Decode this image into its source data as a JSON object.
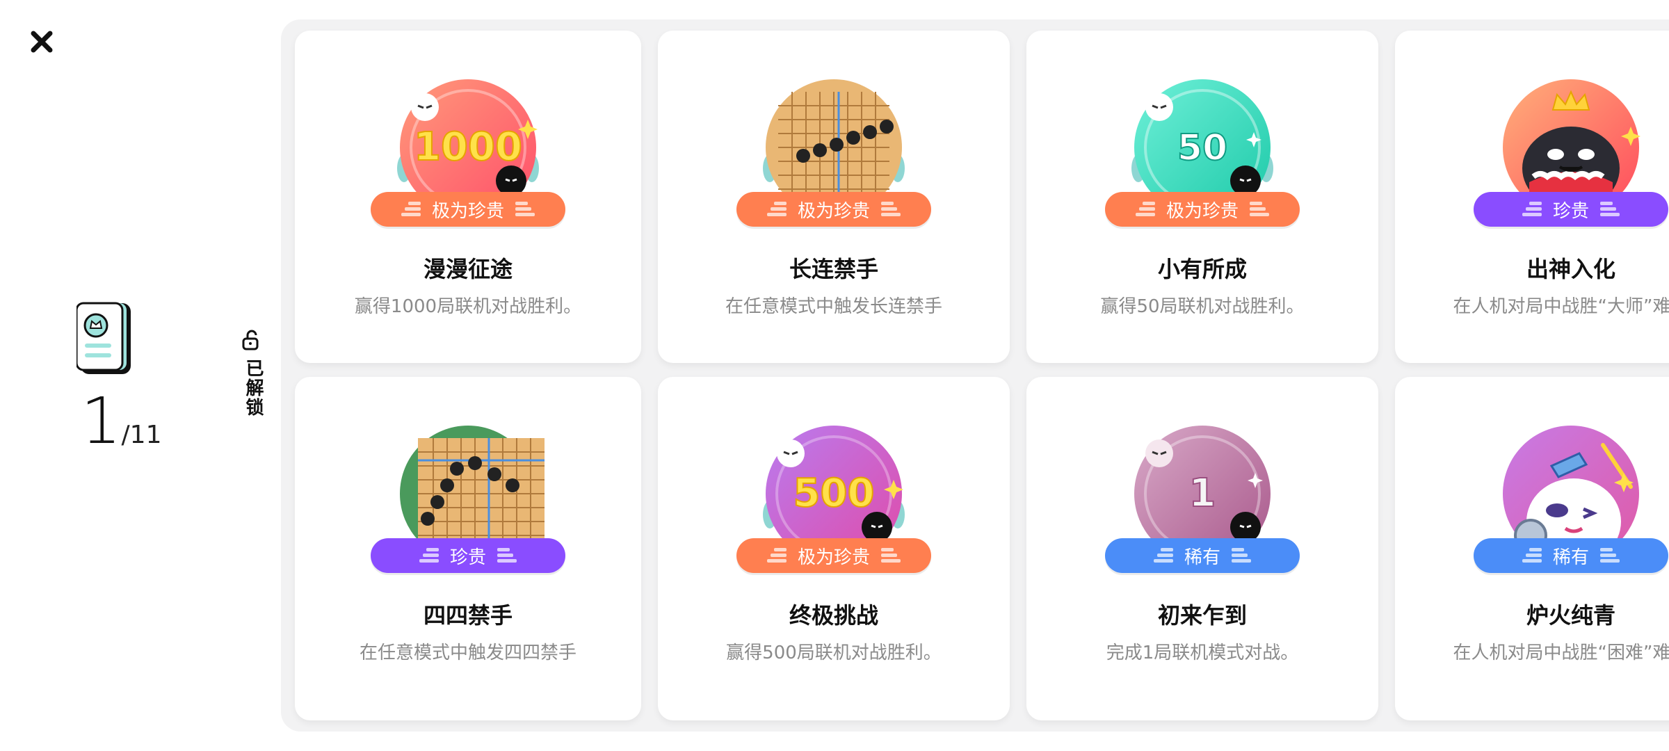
{
  "header": {
    "close_icon": "close-icon"
  },
  "summary": {
    "unlocked": "1",
    "total": "/11",
    "book_icon": "achievement-book-icon"
  },
  "unlocked_label": "已解锁",
  "colors": {
    "very_rare": "#ff7f50",
    "precious": "#8a4dff",
    "rare": "#4b8df8",
    "panel_bg": "#f2f2f3"
  },
  "cards": [
    {
      "rarity": "极为珍贵",
      "rarity_key": "very_rare",
      "title": "漫漫征途",
      "desc": "赢得1000局联机对战胜利。",
      "badge_text": "1000",
      "badge_icon": "badge-1000-icon"
    },
    {
      "rarity": "极为珍贵",
      "rarity_key": "very_rare",
      "title": "长连禁手",
      "desc": "在任意模式中触发长连禁手",
      "badge_text": "",
      "badge_icon": "go-board-long-line-icon"
    },
    {
      "rarity": "极为珍贵",
      "rarity_key": "very_rare",
      "title": "小有所成",
      "desc": "赢得50局联机对战胜利。",
      "badge_text": "50",
      "badge_icon": "badge-50-icon"
    },
    {
      "rarity": "珍贵",
      "rarity_key": "precious",
      "title": "出神入化",
      "desc": "在人机对局中战胜“大师”难度",
      "badge_text": "",
      "badge_icon": "king-master-icon"
    },
    {
      "rarity": "珍贵",
      "rarity_key": "precious",
      "title": "四四禁手",
      "desc": "在任意模式中触发四四禁手",
      "badge_text": "",
      "badge_icon": "go-board-double-four-icon"
    },
    {
      "rarity": "极为珍贵",
      "rarity_key": "very_rare",
      "title": "终极挑战",
      "desc": "赢得500局联机对战胜利。",
      "badge_text": "500",
      "badge_icon": "badge-500-icon"
    },
    {
      "rarity": "稀有",
      "rarity_key": "rare",
      "title": "初来乍到",
      "desc": "完成1局联机模式对战。",
      "badge_text": "1",
      "badge_icon": "badge-1-icon"
    },
    {
      "rarity": "稀有",
      "rarity_key": "rare",
      "title": "炉火纯青",
      "desc": "在人机对局中战胜“困难”难度",
      "badge_text": "",
      "badge_icon": "knight-hard-icon"
    }
  ]
}
